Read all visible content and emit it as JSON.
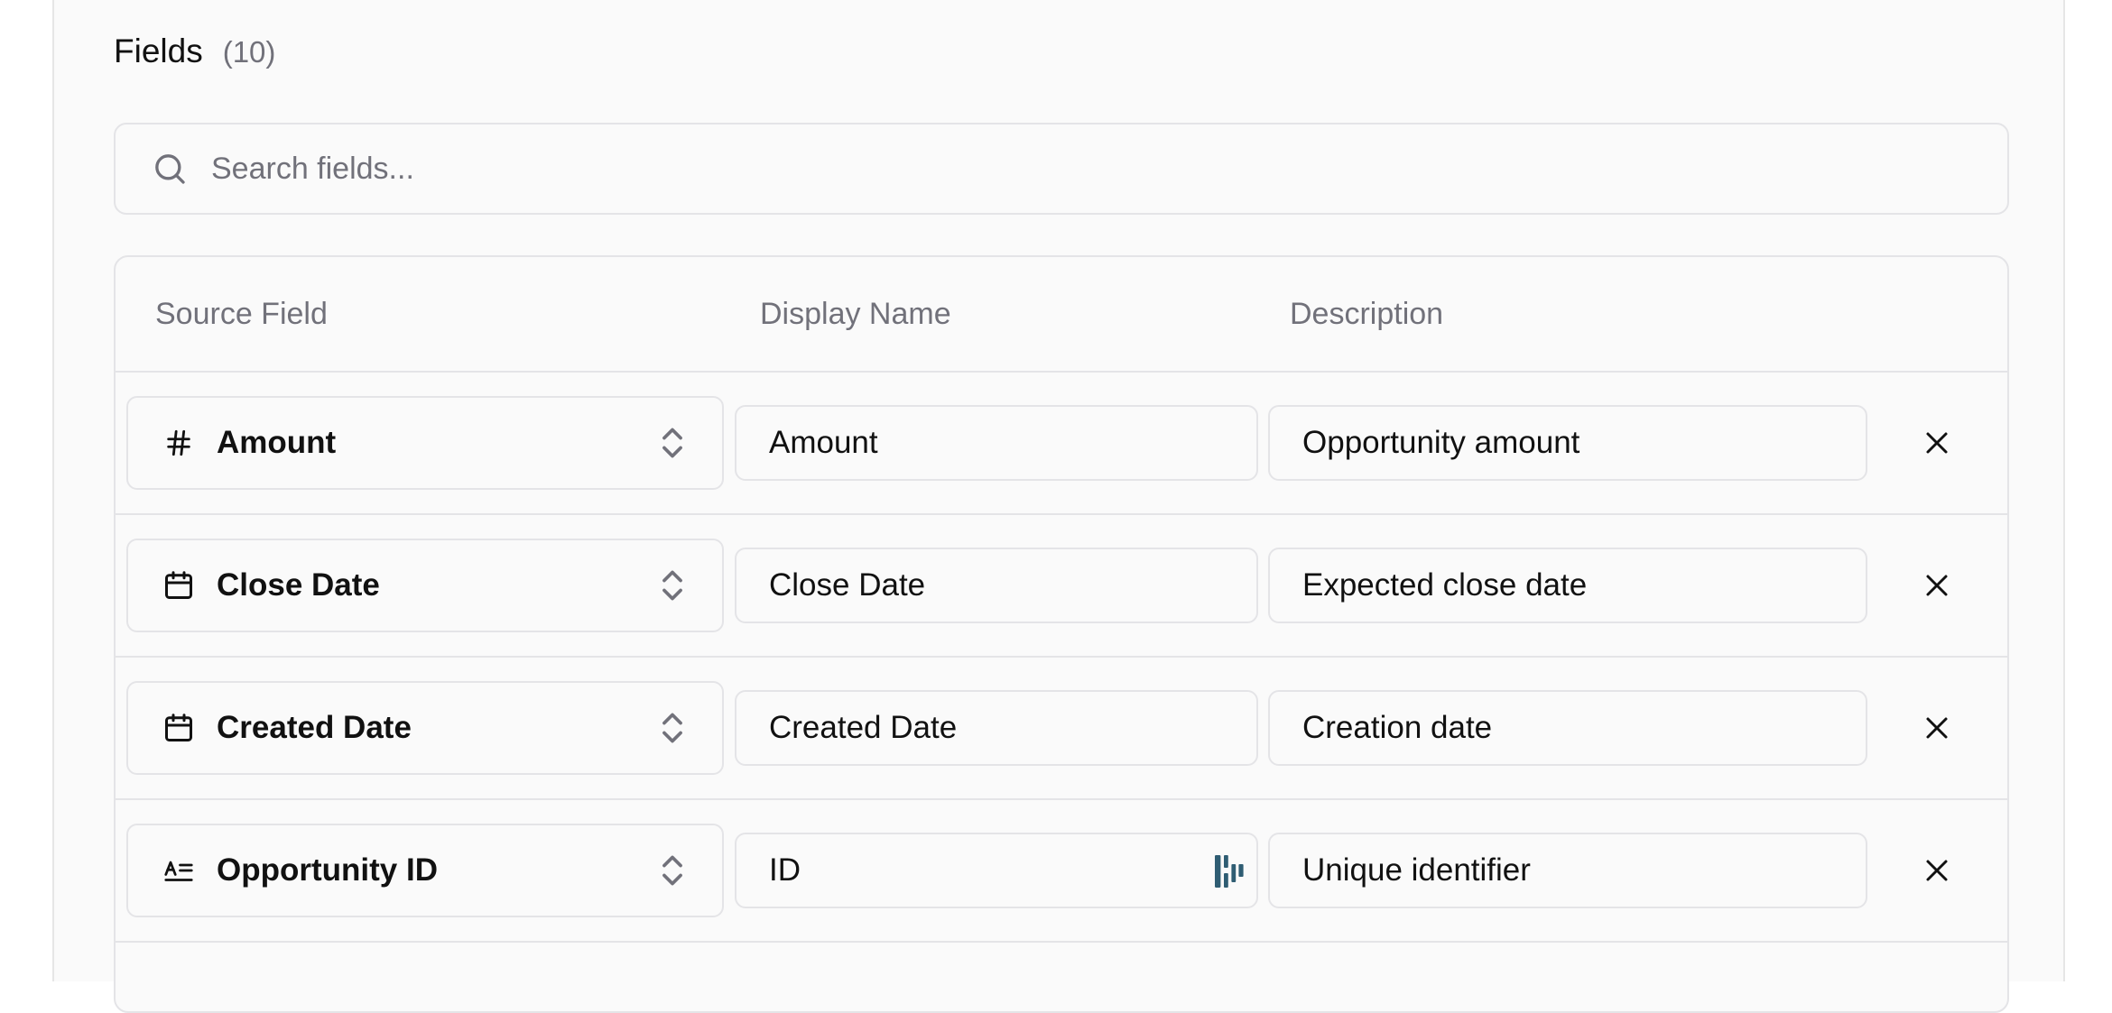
{
  "fields_section": {
    "title": "Fields",
    "count": "(10)"
  },
  "search": {
    "placeholder": "Search fields...",
    "value": ""
  },
  "table": {
    "columns": {
      "source": "Source Field",
      "display": "Display Name",
      "description": "Description"
    },
    "rows": [
      {
        "source": "Amount",
        "type_icon": "hash-icon",
        "display_name": "Amount",
        "description": "Opportunity amount",
        "has_extension_icon": false
      },
      {
        "source": "Close Date",
        "type_icon": "calendar-icon",
        "display_name": "Close Date",
        "description": "Expected close date",
        "has_extension_icon": false
      },
      {
        "source": "Created Date",
        "type_icon": "calendar-icon",
        "display_name": "Created Date",
        "description": "Creation date",
        "has_extension_icon": false
      },
      {
        "source": "Opportunity ID",
        "type_icon": "text-type-icon",
        "display_name": "ID",
        "description": "Unique identifier",
        "has_extension_icon": true
      }
    ]
  },
  "colors": {
    "panel_background": "#fafafa",
    "border": "#e4e4e7",
    "muted_text": "#71717a",
    "text": "#111111",
    "extension_icon": "#2f5d73"
  }
}
